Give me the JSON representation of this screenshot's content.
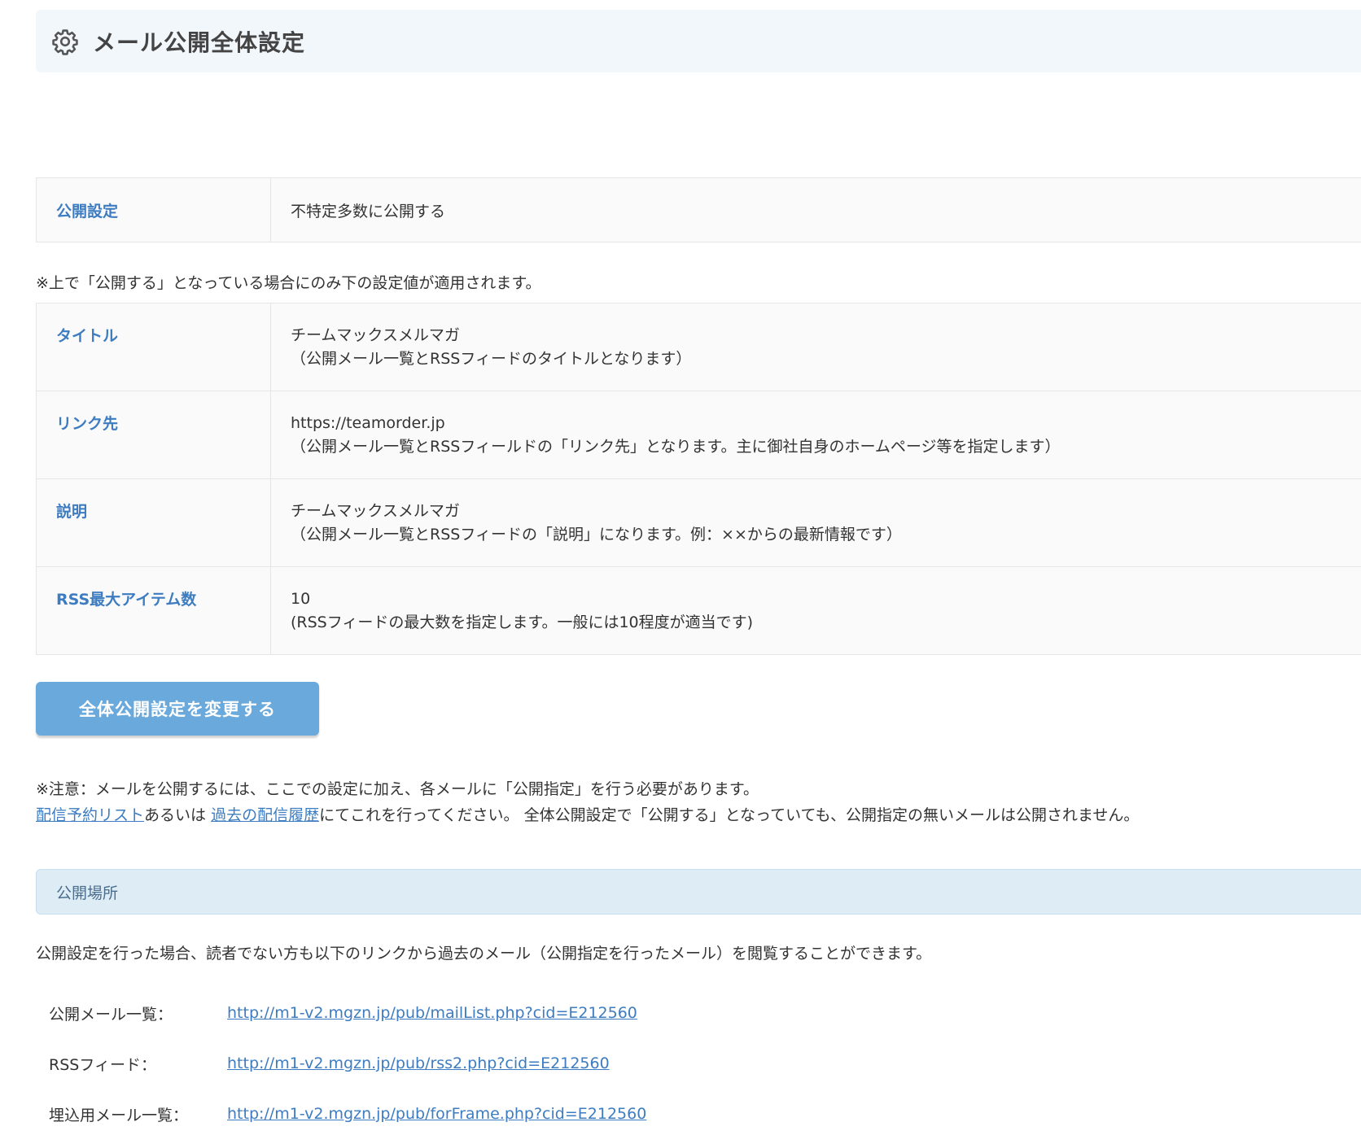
{
  "header": {
    "icon": "gear-icon",
    "title": "メール公開全体設定"
  },
  "publish_table": {
    "label": "公開設定",
    "value": "不特定多数に公開する"
  },
  "note_applies": "※上で「公開する」となっている場合にのみ下の設定値が適用されます。",
  "settings": [
    {
      "label": "タイトル",
      "value": "チームマックスメルマガ",
      "hint": "（公開メール一覧とRSSフィードのタイトルとなります）"
    },
    {
      "label": "リンク先",
      "value": "https://teamorder.jp",
      "hint": "（公開メール一覧とRSSフィールドの「リンク先」となります。主に御社自身のホームページ等を指定します）"
    },
    {
      "label": "説明",
      "value": "チームマックスメルマガ",
      "hint": "（公開メール一覧とRSSフィードの「説明」になります。例：××からの最新情報です）"
    },
    {
      "label": "RSS最大アイテム数",
      "value": "10",
      "hint": "(RSSフィードの最大数を指定します。一般には10程度が適当です)"
    }
  ],
  "change_button": "全体公開設定を変更する",
  "caution": {
    "line1": "※注意：メールを公開するには、ここでの設定に加え、各メールに「公開指定」を行う必要があります。",
    "link1": "配信予約リスト",
    "text_mid": "あるいは ",
    "link2": "過去の配信履歴",
    "text_end": "にてこれを行ってください。 全体公開設定で「公開する」となっていても、公開指定の無いメールは公開されません。"
  },
  "section": {
    "title": "公開場所",
    "description": "公開設定を行った場合、読者でない方も以下のリンクから過去のメール（公開指定を行ったメール）を閲覧することができます。"
  },
  "urls": [
    {
      "label": "公開メール一覧：",
      "url": "http://m1-v2.mgzn.jp/pub/mailList.php?cid=E212560"
    },
    {
      "label": "RSSフィード：",
      "url": "http://m1-v2.mgzn.jp/pub/rss2.php?cid=E212560"
    },
    {
      "label": "埋込用メール一覧：",
      "url": "http://m1-v2.mgzn.jp/pub/forFrame.php?cid=E212560"
    }
  ],
  "colors": {
    "accent": "#3d7cc0",
    "button": "#6aa9dc",
    "header_bg": "#f1f7fb",
    "section_bg": "#deecf6"
  }
}
